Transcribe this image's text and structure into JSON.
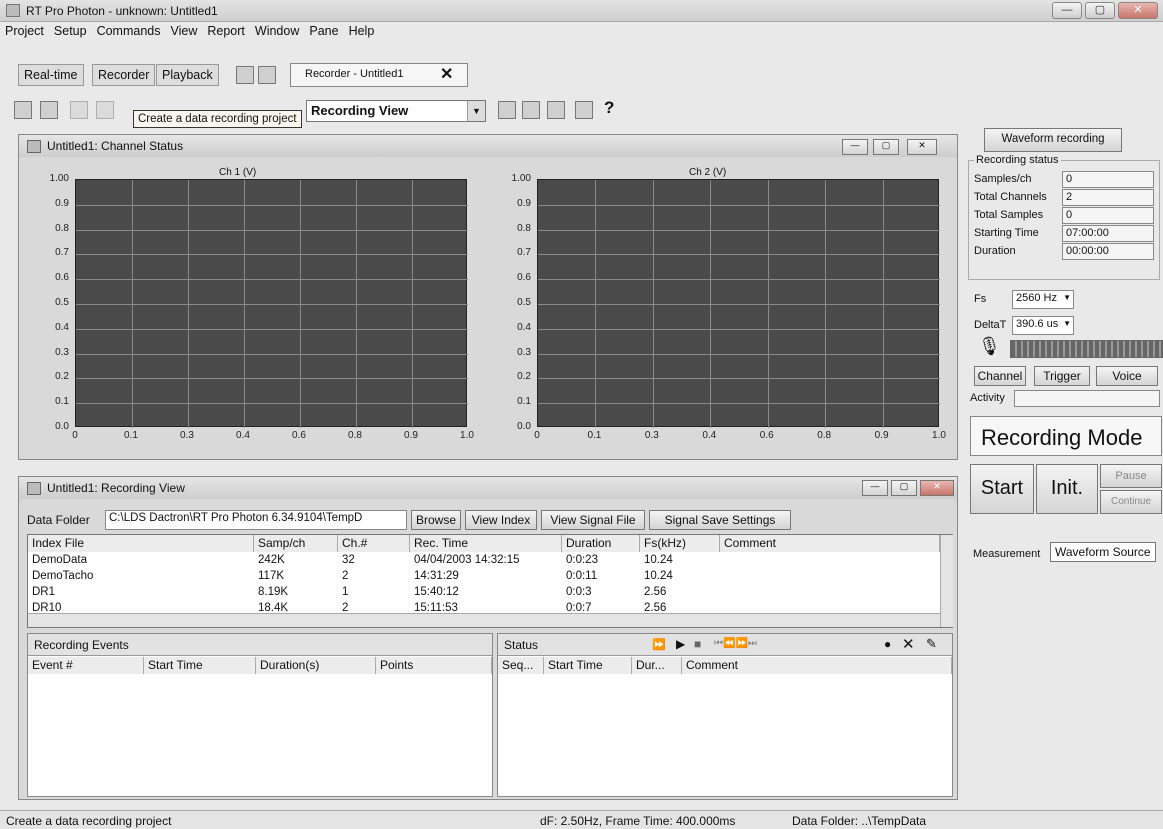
{
  "app": {
    "title": "RT Pro Photon - unknown: Untitled1"
  },
  "menu": [
    "Project",
    "Setup",
    "Commands",
    "View",
    "Report",
    "Window",
    "Pane",
    "Help"
  ],
  "modes": {
    "realtime": "Real-time",
    "recorder": "Recorder",
    "playback": "Playback"
  },
  "doc_tab": "Recorder - Untitled1",
  "view_combo": "Recording View",
  "tooltip": "Create a data recording project",
  "channel_status": {
    "title": "Untitled1: Channel Status",
    "ch1_label": "Ch 1 (V)",
    "ch2_label": "Ch 2 (V)",
    "y_ticks": [
      "1.00",
      "0.9",
      "0.8",
      "0.7",
      "0.6",
      "0.5",
      "0.4",
      "0.3",
      "0.2",
      "0.1",
      "0.0"
    ],
    "x_ticks_ch1": [
      "0",
      "0.1",
      "0.3",
      "0.4",
      "0.6",
      "0.8",
      "0.9",
      "1.0"
    ],
    "x_ticks_ch2": [
      "0",
      "0.1",
      "0.3",
      "0.4",
      "0.6",
      "0.8",
      "0.9",
      "1.0"
    ]
  },
  "right_panel": {
    "waveform_btn": "Waveform recording",
    "group_title": "Recording status",
    "rows": [
      {
        "label": "Samples/ch",
        "value": "0"
      },
      {
        "label": "Total Channels",
        "value": "2"
      },
      {
        "label": "Total Samples",
        "value": "0"
      },
      {
        "label": "Starting Time",
        "value": "07:00:00"
      },
      {
        "label": "Duration",
        "value": "00:00:00"
      }
    ],
    "fs_label": "Fs",
    "fs_value": "2560 Hz",
    "deltat_label": "DeltaT",
    "deltat_value": "390.6 us",
    "channel_btn": "Channel",
    "trigger_btn": "Trigger",
    "voice_btn": "Voice",
    "activity_label": "Activity",
    "mode_text": "Recording Mode",
    "start_btn": "Start",
    "init_btn": "Init.",
    "pause_btn": "Pause",
    "continue_btn": "Continue",
    "measurement_tab": "Measurement",
    "waveform_source_tab": "Waveform Source"
  },
  "recording_view": {
    "title": "Untitled1: Recording View",
    "data_folder_label": "Data Folder",
    "data_folder_value": "C:\\LDS Dactron\\RT Pro Photon 6.34.9104\\TempD",
    "browse_btn": "Browse",
    "view_index_btn": "View Index",
    "view_signal_btn": "View Signal File",
    "signal_save_btn": "Signal Save Settings",
    "columns": [
      "Index File",
      "Samp/ch",
      "Ch.#",
      "Rec. Time",
      "Duration",
      "Fs(kHz)",
      "Comment"
    ],
    "rows": [
      [
        "DemoData",
        "242K",
        "32",
        "04/04/2003 14:32:15",
        "0:0:23",
        "10.24",
        ""
      ],
      [
        "DemoTacho",
        "117K",
        "2",
        "14:31:29",
        "0:0:11",
        "10.24",
        ""
      ],
      [
        "DR1",
        "8.19K",
        "1",
        "15:40:12",
        "0:0:3",
        "2.56",
        ""
      ],
      [
        "DR10",
        "18.4K",
        "2",
        "15:11:53",
        "0:0:7",
        "2.56",
        ""
      ]
    ]
  },
  "events": {
    "title": "Recording Events",
    "columns": [
      "Event #",
      "Start Time",
      "Duration(s)",
      "Points"
    ]
  },
  "status_panel": {
    "title": "Status",
    "columns": [
      "Seq...",
      "Start Time",
      "Dur...",
      "Comment"
    ]
  },
  "statusbar": {
    "left": "Create a data recording project",
    "mid": "dF: 2.50Hz, Frame Time: 400.000ms",
    "right": "Data Folder: ..\\TempData"
  }
}
